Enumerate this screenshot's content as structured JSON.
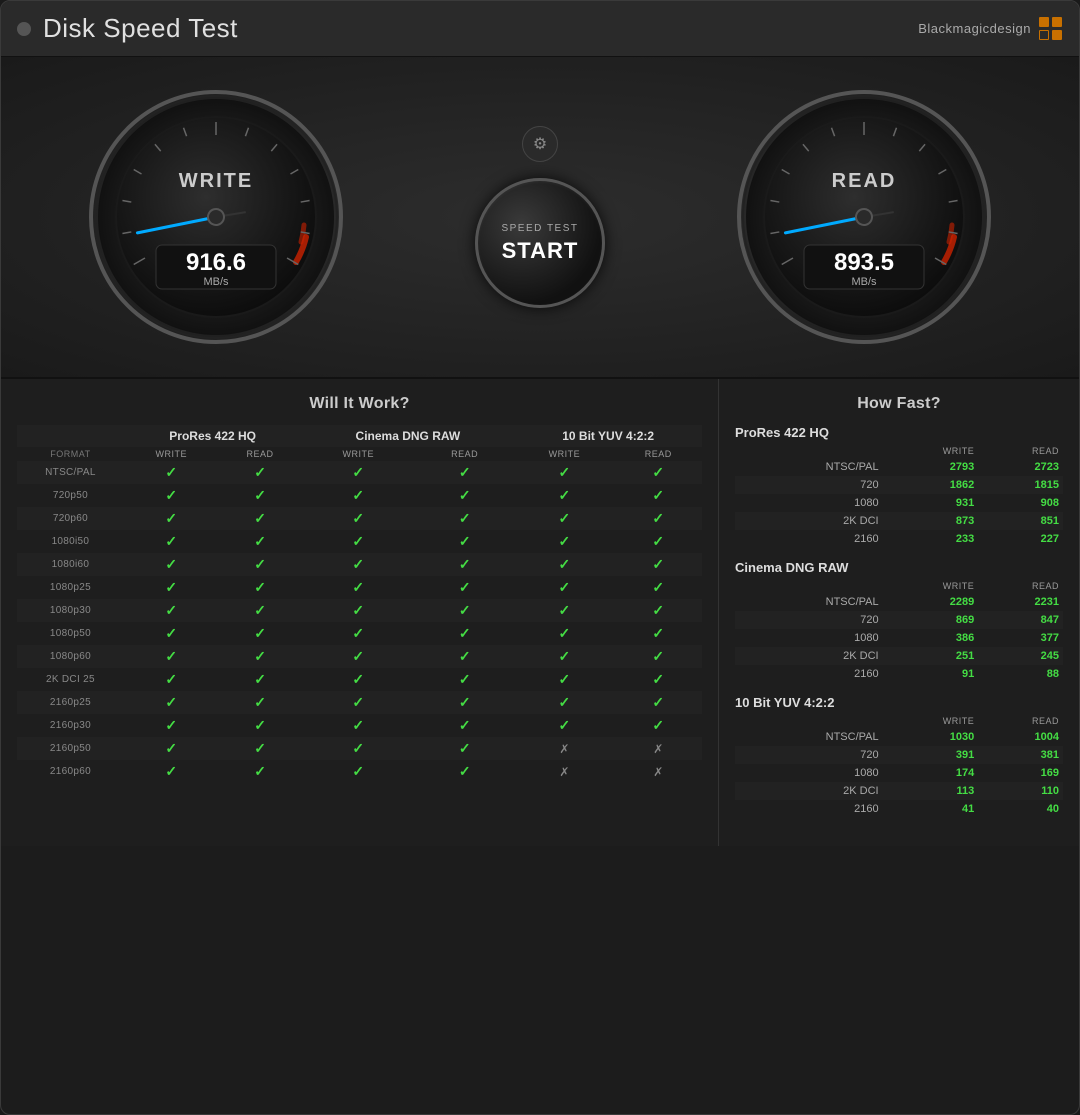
{
  "app": {
    "title": "Disk Speed Test",
    "close_label": "×"
  },
  "brand": {
    "name": "Blackmagicdesign"
  },
  "gauges": {
    "write": {
      "label": "WRITE",
      "value": "916.6",
      "unit": "MB/s"
    },
    "read": {
      "label": "READ",
      "value": "893.5",
      "unit": "MB/s"
    }
  },
  "start_button": {
    "label_top": "SPEED TEST",
    "label_bottom": "START"
  },
  "sections": {
    "will_it_work": {
      "title": "Will It Work?",
      "codecs": [
        "ProRes 422 HQ",
        "Cinema DNG RAW",
        "10 Bit YUV 4:2:2"
      ],
      "sub_headers": [
        "WRITE",
        "READ",
        "WRITE",
        "READ",
        "WRITE",
        "READ"
      ],
      "format_col": "FORMAT",
      "formats": [
        "NTSC/PAL",
        "720p50",
        "720p60",
        "1080i50",
        "1080i60",
        "1080p25",
        "1080p30",
        "1080p50",
        "1080p60",
        "2K DCI 25",
        "2160p25",
        "2160p30",
        "2160p50",
        "2160p60"
      ],
      "rows": [
        [
          "✓",
          "✓",
          "✓",
          "✓",
          "✓",
          "✓"
        ],
        [
          "✓",
          "✓",
          "✓",
          "✓",
          "✓",
          "✓"
        ],
        [
          "✓",
          "✓",
          "✓",
          "✓",
          "✓",
          "✓"
        ],
        [
          "✓",
          "✓",
          "✓",
          "✓",
          "✓",
          "✓"
        ],
        [
          "✓",
          "✓",
          "✓",
          "✓",
          "✓",
          "✓"
        ],
        [
          "✓",
          "✓",
          "✓",
          "✓",
          "✓",
          "✓"
        ],
        [
          "✓",
          "✓",
          "✓",
          "✓",
          "✓",
          "✓"
        ],
        [
          "✓",
          "✓",
          "✓",
          "✓",
          "✓",
          "✓"
        ],
        [
          "✓",
          "✓",
          "✓",
          "✓",
          "✓",
          "✓"
        ],
        [
          "✓",
          "✓",
          "✓",
          "✓",
          "✓",
          "✓"
        ],
        [
          "✓",
          "✓",
          "✓",
          "✓",
          "✓",
          "✓"
        ],
        [
          "✓",
          "✓",
          "✓",
          "✓",
          "✓",
          "✓"
        ],
        [
          "✓",
          "✓",
          "✓",
          "✓",
          "✗",
          "✗"
        ],
        [
          "✓",
          "✓",
          "✓",
          "✓",
          "✗",
          "✗"
        ]
      ]
    },
    "how_fast": {
      "title": "How Fast?",
      "groups": [
        {
          "codec": "ProRes 422 HQ",
          "formats": [
            "NTSC/PAL",
            "720",
            "1080",
            "2K DCI",
            "2160"
          ],
          "writes": [
            "2793",
            "1862",
            "931",
            "873",
            "233"
          ],
          "reads": [
            "2723",
            "1815",
            "908",
            "851",
            "227"
          ],
          "dim": [
            false,
            false,
            false,
            false,
            false
          ]
        },
        {
          "codec": "Cinema DNG RAW",
          "formats": [
            "NTSC/PAL",
            "720",
            "1080",
            "2K DCI",
            "2160"
          ],
          "writes": [
            "2289",
            "869",
            "386",
            "251",
            "91"
          ],
          "reads": [
            "2231",
            "847",
            "377",
            "245",
            "88"
          ],
          "dim": [
            false,
            false,
            false,
            false,
            false
          ]
        },
        {
          "codec": "10 Bit YUV 4:2:2",
          "formats": [
            "NTSC/PAL",
            "720",
            "1080",
            "2K DCI",
            "2160"
          ],
          "writes": [
            "1030",
            "391",
            "174",
            "113",
            "41"
          ],
          "reads": [
            "1004",
            "381",
            "169",
            "110",
            "40"
          ],
          "dim": [
            false,
            false,
            false,
            false,
            false
          ]
        }
      ]
    }
  }
}
